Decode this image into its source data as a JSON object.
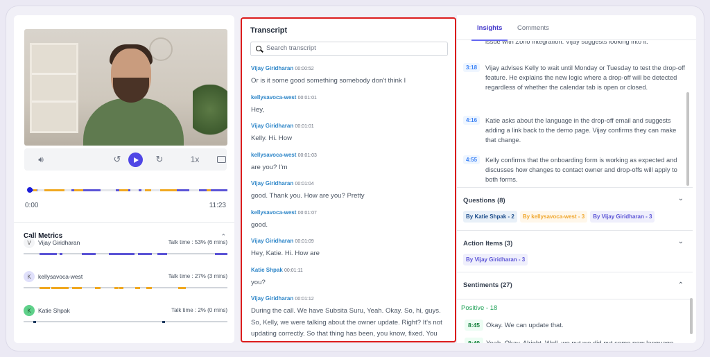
{
  "player": {
    "current_time": "0:00",
    "duration": "11:23",
    "speed": "1x",
    "progress": 0
  },
  "call_metrics": {
    "title": "Call Metrics",
    "speakers": [
      {
        "initial": "V",
        "name": "Vijay Giridharan",
        "talk_time": "Talk time : 53% (6 mins)",
        "color": "#5b54d6",
        "avatar_bg": "#f3f4f6"
      },
      {
        "initial": "K",
        "name": "kellysavoca-west",
        "talk_time": "Talk time : 27% (3 mins)",
        "color": "#f0a820",
        "avatar_bg": "#e0e0fb"
      },
      {
        "initial": "K",
        "name": "Katie Shpak",
        "talk_time": "Talk time : 2% (0 mins)",
        "color": "#1e3a5f",
        "avatar_bg": "#5fd18a"
      }
    ]
  },
  "transcript": {
    "title": "Transcript",
    "search_placeholder": "Search transcript",
    "entries": [
      {
        "speaker": "Vijay Giridharan",
        "time": "00:00:52",
        "text": "Or is it some good something somebody don't think I"
      },
      {
        "speaker": "kellysavoca-west",
        "time": "00:01:01",
        "text": "Hey,"
      },
      {
        "speaker": "Vijay Giridharan",
        "time": "00:01:01",
        "text": "Kelly. Hi. How"
      },
      {
        "speaker": "kellysavoca-west",
        "time": "00:01:03",
        "text": "are you? I'm"
      },
      {
        "speaker": "Vijay Giridharan",
        "time": "00:01:04",
        "text": "good. Thank you. How are you? Pretty"
      },
      {
        "speaker": "kellysavoca-west",
        "time": "00:01:07",
        "text": "good."
      },
      {
        "speaker": "Vijay Giridharan",
        "time": "00:01:09",
        "text": "Hey, Katie. Hi. How are"
      },
      {
        "speaker": "Katie Shpak",
        "time": "00:01:11",
        "text": "you?"
      },
      {
        "speaker": "Vijay Giridharan",
        "time": "00:01:12",
        "text": "During the call. We have Subsita Suru, Yeah. Okay. So, hi, guys. So, Kelly, we were talking about the owner update. Right? It's not updating correctly. So that thing has been, you know, fixed. You can actually try it right"
      }
    ]
  },
  "insights_panel": {
    "tabs": [
      {
        "label": "Insights",
        "active": true
      },
      {
        "label": "Comments",
        "active": false
      }
    ],
    "partial_text": "issue with Zono integration. Vijay suggests looking into it.",
    "items": [
      {
        "time": "3:18",
        "text": "Vijay advises Kelly to wait until Monday or Tuesday to test the drop-off feature. He explains the new logic where a drop-off will be detected regardless of whether the calendar tab is open or closed."
      },
      {
        "time": "4:16",
        "text": "Katie asks about the language in the drop-off email and suggests adding a link back to the demo page. Vijay confirms they can make that change."
      },
      {
        "time": "4:55",
        "text": "Kelly confirms that the onboarding form is working as expected and discusses how changes to contact owner and drop-offs will apply to both forms."
      }
    ],
    "questions": {
      "title": "Questions (8)",
      "chips": [
        {
          "label": "By Katie Shpak - 2",
          "color": "#1e4e8c",
          "bg": "#e8f0f8"
        },
        {
          "label": "By kellysavoca-west - 3",
          "color": "#f0a830",
          "bg": "#fff7ea"
        },
        {
          "label": "By Vijay Giridharan - 3",
          "color": "#5b54d6",
          "bg": "#efeffc"
        }
      ]
    },
    "action_items": {
      "title": "Action Items (3)",
      "chips": [
        {
          "label": "By Vijay Giridharan - 3",
          "color": "#5b54d6",
          "bg": "#efeffc"
        }
      ]
    },
    "sentiments": {
      "title": "Sentiments (27)",
      "positive_label": "Positive - 18",
      "items": [
        {
          "time": "8:45",
          "text": "Okay. We can update that."
        },
        {
          "time": "8:49",
          "text": "Yeah. Okay. Alright. Well, we put we did put some new language"
        }
      ]
    }
  }
}
